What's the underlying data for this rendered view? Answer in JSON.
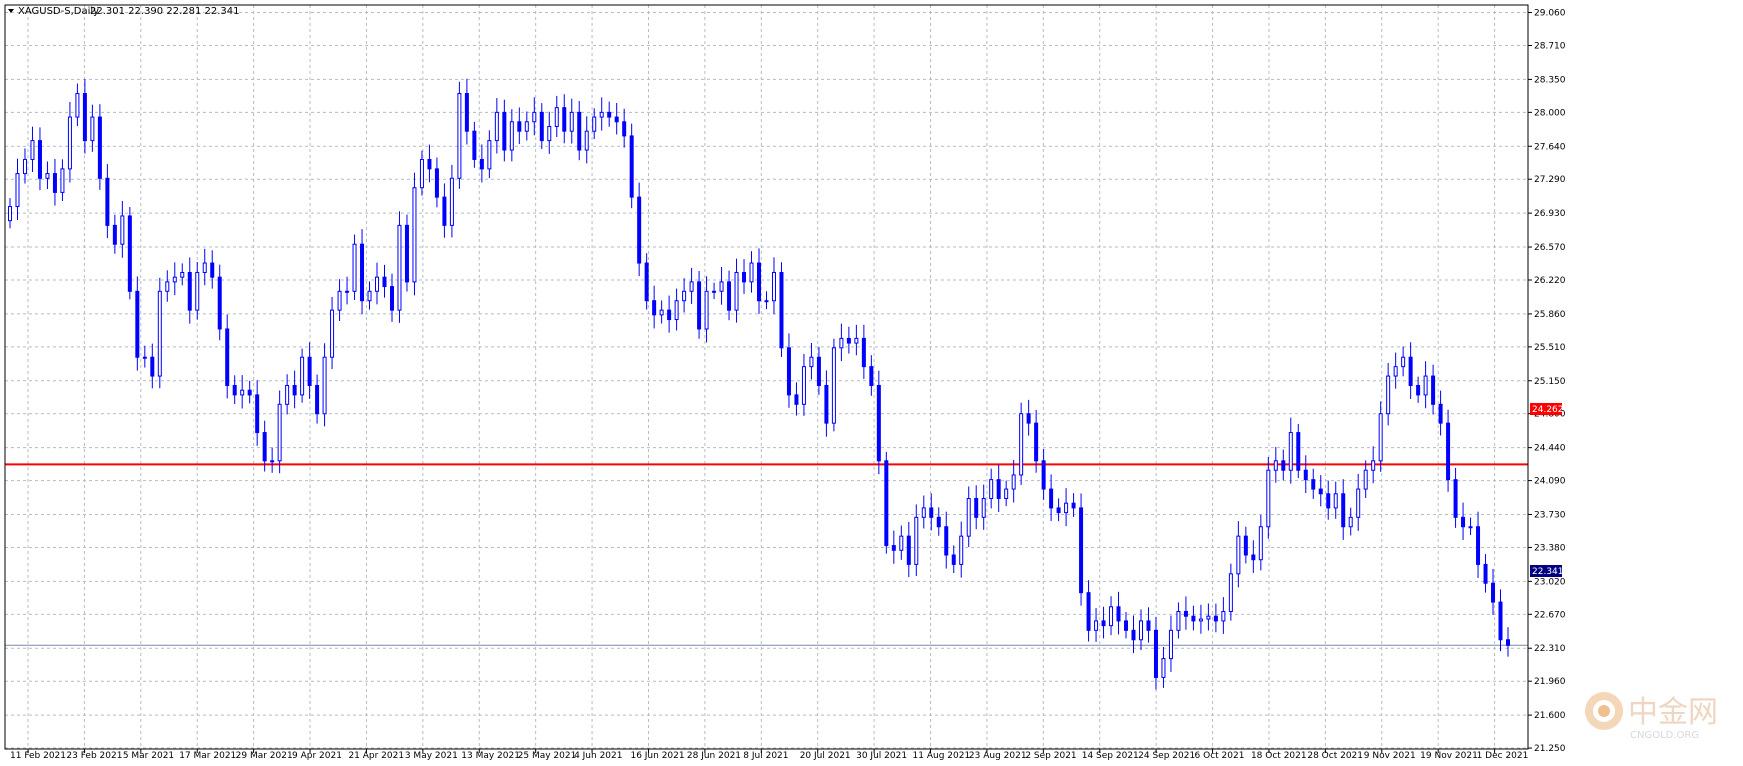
{
  "header": {
    "collapse_icon": "triangle-down-icon",
    "symbol": "XAGUSD-S",
    "timeframe": "Daily",
    "ohlc": "22.301 22.390 22.281 22.341"
  },
  "watermark": {
    "logo_icon": "zhongjin-logo-icon",
    "text": "中金网",
    "subtext": "CNGOLD.ORG"
  },
  "colors": {
    "background": "#ffffff",
    "grid": "#b4bcc8",
    "frame": "#000000",
    "candle": "#0000ff",
    "level_line": "#ff0000",
    "current_price_bg": "#000080"
  },
  "chart_data": {
    "type": "candlestick",
    "title": "XAGUSD-S,Daily",
    "grid": true,
    "ylim": [
      21.24,
      29.14
    ],
    "y_ticks": [
      "29.060",
      "28.710",
      "28.350",
      "28.000",
      "27.640",
      "27.290",
      "26.930",
      "26.570",
      "26.220",
      "25.860",
      "25.510",
      "25.150",
      "24.800",
      "24.440",
      "24.090",
      "23.730",
      "23.380",
      "23.020",
      "22.670",
      "22.310",
      "21.960",
      "21.600",
      "21.250"
    ],
    "x_ticks": [
      "11 Feb 2021",
      "23 Feb 2021",
      "5 Mar 2021",
      "17 Mar 2021",
      "29 Mar 2021",
      "9 Apr 2021",
      "21 Apr 2021",
      "3 May 2021",
      "13 May 2021",
      "25 May 2021",
      "4 Jun 2021",
      "16 Jun 2021",
      "28 Jun 2021",
      "8 Jul 2021",
      "20 Jul 2021",
      "30 Jul 2021",
      "11 Aug 2021",
      "23 Aug 2021",
      "2 Sep 2021",
      "14 Sep 2021",
      "24 Sep 2021",
      "6 Oct 2021",
      "18 Oct 2021",
      "28 Oct 2021",
      "9 Nov 2021",
      "19 Nov 2021",
      "1 Dec 2021"
    ],
    "levels": [
      {
        "value": "24.262",
        "color": "#ff0000"
      }
    ],
    "current_price": "22.341",
    "closes": [
      27.0,
      27.35,
      27.5,
      27.7,
      27.3,
      27.35,
      27.15,
      27.4,
      27.95,
      28.2,
      27.7,
      27.95,
      27.3,
      26.8,
      26.6,
      26.9,
      26.1,
      25.4,
      25.4,
      25.2,
      26.1,
      26.2,
      26.25,
      26.3,
      25.9,
      26.3,
      26.4,
      26.25,
      25.7,
      25.1,
      25.0,
      25.05,
      25.0,
      24.6,
      24.3,
      24.3,
      24.9,
      25.1,
      25.0,
      25.4,
      25.1,
      24.8,
      25.4,
      25.9,
      26.1,
      26.1,
      26.6,
      26.0,
      26.1,
      26.25,
      26.15,
      25.9,
      26.8,
      26.2,
      27.2,
      27.5,
      27.4,
      27.1,
      26.8,
      27.3,
      28.2,
      27.8,
      27.5,
      27.4,
      27.7,
      28.0,
      27.6,
      27.9,
      27.8,
      27.9,
      28.0,
      27.7,
      27.85,
      28.05,
      27.8,
      28.0,
      27.6,
      27.8,
      27.95,
      28.0,
      27.95,
      27.9,
      27.75,
      27.1,
      26.4,
      26.0,
      25.85,
      25.9,
      25.8,
      26.0,
      26.1,
      26.2,
      25.7,
      26.1,
      26.1,
      26.2,
      25.9,
      26.3,
      26.2,
      26.4,
      26.0,
      26.0,
      26.3,
      25.5,
      25.0,
      24.9,
      25.3,
      25.4,
      25.1,
      24.7,
      25.5,
      25.6,
      25.55,
      25.6,
      25.3,
      25.1,
      24.3,
      23.4,
      23.35,
      23.5,
      23.2,
      23.7,
      23.8,
      23.7,
      23.6,
      23.3,
      23.2,
      23.5,
      23.9,
      23.7,
      23.9,
      24.1,
      23.9,
      24.0,
      24.15,
      24.8,
      24.7,
      24.3,
      24.0,
      23.8,
      23.75,
      23.85,
      23.8,
      22.9,
      22.5,
      22.6,
      22.55,
      22.75,
      22.6,
      22.5,
      22.4,
      22.6,
      22.5,
      22.0,
      22.2,
      22.5,
      22.7,
      22.65,
      22.6,
      22.62,
      22.65,
      22.6,
      22.7,
      23.1,
      23.5,
      23.3,
      23.25,
      23.6,
      24.2,
      24.3,
      24.2,
      24.6,
      24.2,
      24.1,
      24.0,
      23.95,
      23.8,
      23.95,
      23.6,
      23.7,
      24.0,
      24.2,
      24.3,
      24.8,
      25.2,
      25.3,
      25.4,
      25.1,
      25.0,
      25.2,
      24.9,
      24.7,
      24.1,
      23.7,
      23.6,
      23.6,
      23.2,
      23.0,
      22.8,
      22.4,
      22.341
    ]
  }
}
